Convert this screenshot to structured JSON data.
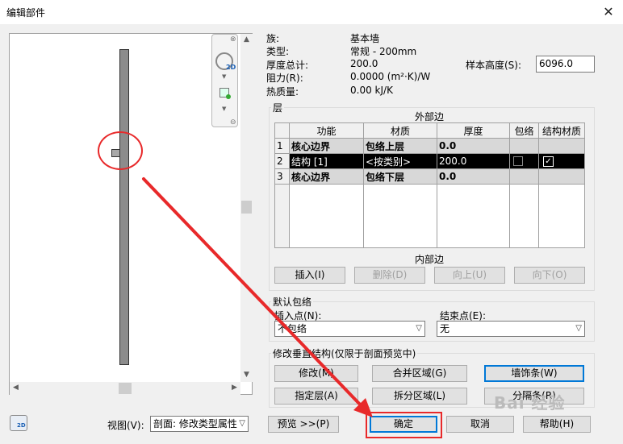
{
  "window": {
    "title": "编辑部件",
    "close_glyph": "✕"
  },
  "props": {
    "family_label": "族:",
    "family_value": "基本墙",
    "type_label": "类型:",
    "type_value": "常规 - 200mm",
    "thickness_label": "厚度总计:",
    "thickness_value": "200.0",
    "resistance_label": "阻力(R):",
    "resistance_value": "0.0000 (m²·K)/W",
    "thermal_label": "热质量:",
    "thermal_value": "0.00 kJ/K",
    "sample_height_label": "样本高度(S):",
    "sample_height_value": "6096.0"
  },
  "layers": {
    "group_title": "层",
    "exterior_label": "外部边",
    "interior_label": "内部边",
    "columns": [
      "功能",
      "材质",
      "厚度",
      "包络",
      "结构材质"
    ],
    "rows": [
      {
        "num": "1",
        "function": "核心边界",
        "material": "包络上层",
        "thickness": "0.0"
      },
      {
        "num": "2",
        "function": "结构 [1]",
        "material": "<按类别>",
        "thickness": "200.0"
      },
      {
        "num": "3",
        "function": "核心边界",
        "material": "包络下层",
        "thickness": "0.0"
      }
    ],
    "buttons": {
      "insert": "插入(I)",
      "delete": "删除(D)",
      "up": "向上(U)",
      "down": "向下(O)"
    }
  },
  "wrapping": {
    "group_title": "默认包络",
    "insert_label": "插入点(N):",
    "insert_value": "不包络",
    "end_label": "结束点(E):",
    "end_value": "无"
  },
  "vertical": {
    "group_title": "修改垂直结构(仅限于剖面预览中)",
    "modify": "修改(M)",
    "merge": "合并区域(G)",
    "sweeps": "墙饰条(W)",
    "assign": "指定层(A)",
    "split": "拆分区域(L)",
    "reveals": "分隔条(R)"
  },
  "bottom": {
    "view_label": "视图(V):",
    "view_value": "剖面: 修改类型属性",
    "preview": "预览 >>(P)",
    "ok": "确定",
    "cancel": "取消",
    "help": "帮助(H)"
  },
  "navbar": {
    "nav_2d": "2D"
  },
  "watermark": "Bai 经验",
  "colors": {
    "annotation_red": "#e8292a",
    "selected_row": "#000000",
    "focus_blue": "#0078d7"
  }
}
